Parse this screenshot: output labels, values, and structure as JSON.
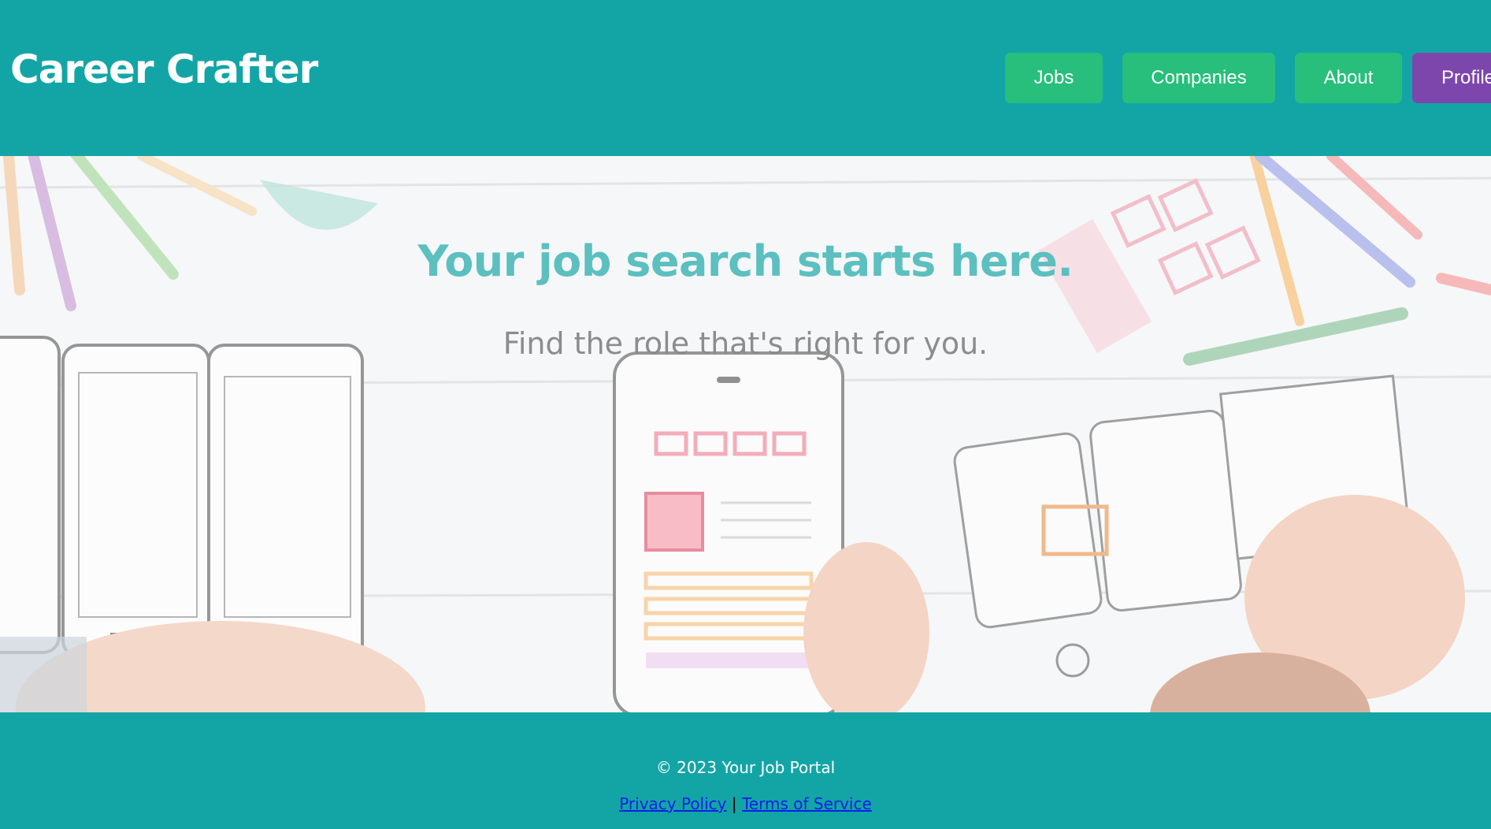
{
  "header": {
    "brand": "Career Crafter",
    "nav": {
      "jobs": "Jobs",
      "companies": "Companies",
      "about": "About",
      "profile": "Profile"
    }
  },
  "hero": {
    "title": "Your job search starts here.",
    "subtitle": "Find the role that's right for you."
  },
  "footer": {
    "copyright": "© 2023 Your Job Portal",
    "privacy": "Privacy Policy",
    "separator": "|",
    "terms": "Terms of Service"
  },
  "colors": {
    "header_bg": "#13a5a6",
    "nav_button": "#27bf7b",
    "profile_button": "#7d46ad",
    "hero_title": "#5cbfc0",
    "hero_subtitle": "#8c8c8c",
    "link": "#0a1ee6"
  }
}
